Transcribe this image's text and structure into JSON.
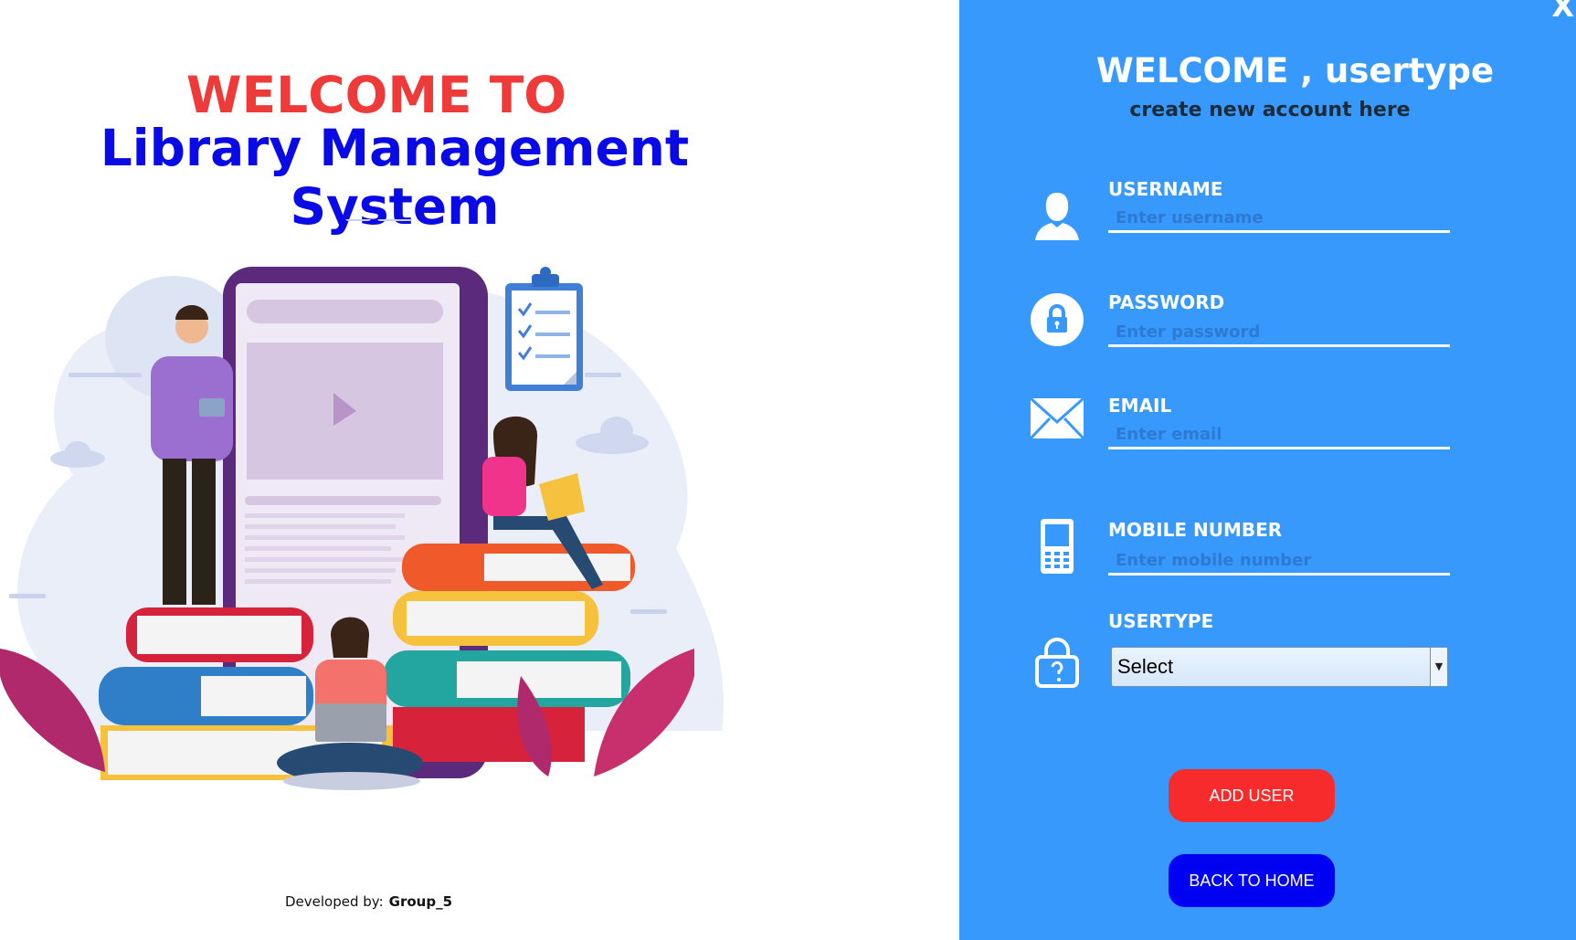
{
  "left": {
    "welcome": "WELCOME TO",
    "title": "Library Management System",
    "credit_label": "Developed by:",
    "credit_value": "Group_5"
  },
  "form": {
    "close_label": "X",
    "title": "WELCOME , usertype",
    "subtitle": "create new account here",
    "fields": {
      "username": {
        "label": "USERNAME",
        "placeholder": "Enter username"
      },
      "password": {
        "label": "PASSWORD",
        "placeholder": "Enter password"
      },
      "email": {
        "label": "EMAIL",
        "placeholder": "Enter email"
      },
      "mobile": {
        "label": "MOBILE NUMBER",
        "placeholder": "Enter mobile number"
      },
      "usertype": {
        "label": "USERTYPE",
        "selected": "Select"
      }
    },
    "add_user_label": "ADD USER",
    "back_home_label": "BACK TO HOME"
  },
  "colors": {
    "panel_bg": "#3799fb",
    "welcome_red": "#ef3a3a",
    "title_blue": "#0a0ae6",
    "add_button": "#f72b2b",
    "home_button": "#0000f2"
  },
  "icons": [
    "user-icon",
    "lock-circle-icon",
    "envelope-icon",
    "mobile-phone-icon",
    "question-lock-icon"
  ]
}
